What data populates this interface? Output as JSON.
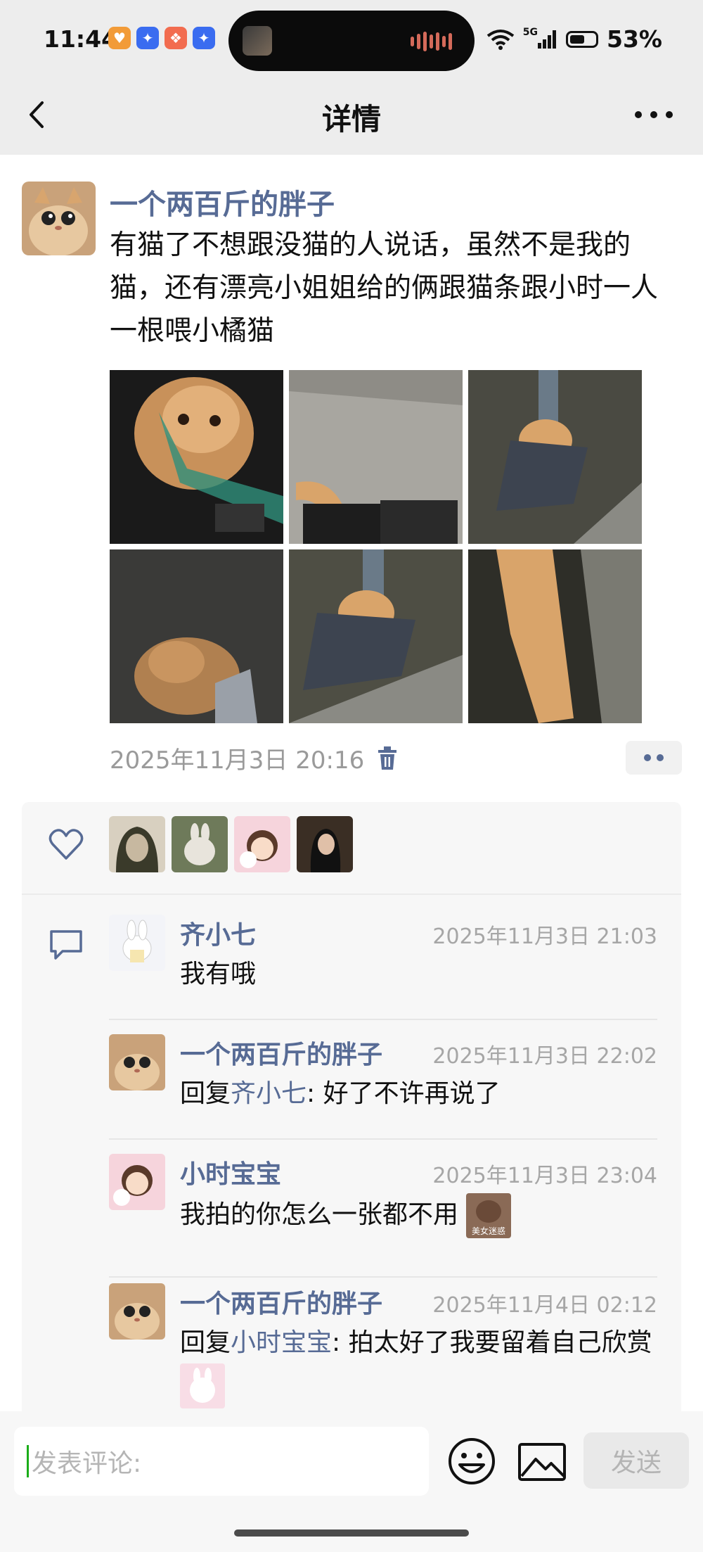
{
  "status_bar": {
    "time": "11:44",
    "network": "5G",
    "battery": "53%"
  },
  "nav": {
    "title": "详情"
  },
  "post": {
    "author": "一个两百斤的胖子",
    "text": "有猫了不想跟没猫的人说话，虽然不是我的猫，还有漂亮小姐姐给的俩跟猫条跟小时一人一根喂小橘猫",
    "timestamp": "2025年11月3日 20:16",
    "photos": [
      "cat-photo",
      "cat-photo",
      "cat-photo",
      "cat-photo",
      "cat-photo",
      "cat-photo"
    ]
  },
  "likes": {
    "count_avatars": 4
  },
  "comments": [
    {
      "name": "齐小七",
      "time": "2025年11月3日 21:03",
      "prefix": "",
      "reply_to": "",
      "sep": "",
      "text": "我有哦"
    },
    {
      "name": "一个两百斤的胖子",
      "time": "2025年11月3日 22:02",
      "prefix": "回复",
      "reply_to": "齐小七",
      "sep": ": ",
      "text": "好了不许再说了"
    },
    {
      "name": "小时宝宝",
      "time": "2025年11月3日 23:04",
      "prefix": "",
      "reply_to": "",
      "sep": "",
      "text": "我拍的你怎么一张都不用",
      "sticker_caption": "美女迷惑"
    },
    {
      "name": "一个两百斤的胖子",
      "time": "2025年11月4日 02:12",
      "prefix": "回复",
      "reply_to": "小时宝宝",
      "sep": ": ",
      "text": "拍太好了我要留着自己欣赏"
    }
  ],
  "composer": {
    "placeholder": "发表评论:",
    "send_label": "发送"
  },
  "colors": {
    "link": "#576b95",
    "header_bg": "#ededed",
    "panel_bg": "#f7f7f7"
  }
}
